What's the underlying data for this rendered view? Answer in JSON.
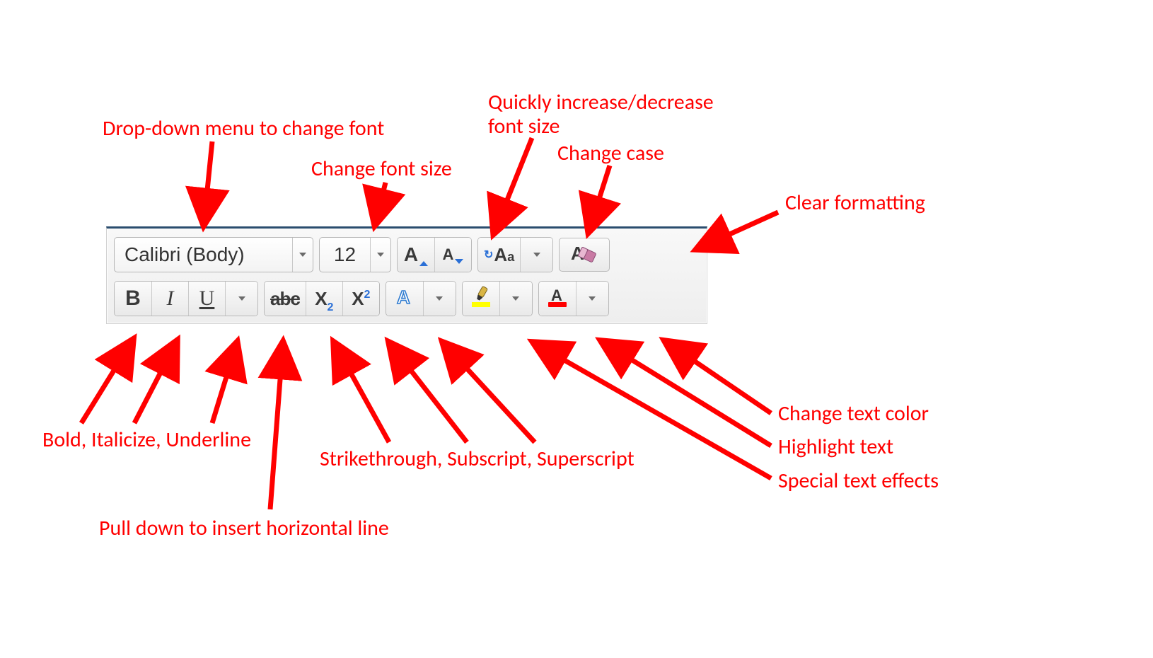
{
  "toolbar": {
    "font_name": "Calibri (Body)",
    "font_size": "12",
    "increaseA": "A",
    "decreaseA": "A",
    "changeCaseA": "A",
    "changeCasea": "a",
    "clearA": "A",
    "boldB": "B",
    "italicI": "I",
    "underlineU": "U",
    "strike_abc": "abc",
    "sub_X": "X",
    "sub_2": "2",
    "sup_X": "X",
    "sup_2": "2",
    "effectsA": "A",
    "highlight_color": "#ffff00",
    "font_color": "#ff0000"
  },
  "labels": {
    "font_dropdown": "Drop-down menu to change font",
    "font_size_label": "Change font size",
    "inc_dec_line1": "Quickly increase/decrease",
    "inc_dec_line2": "font size",
    "change_case": "Change case",
    "clear_formatting": "Clear formatting",
    "biu": "Bold, Italicize, Underline",
    "hr_line": "Pull down to insert horizontal line",
    "sss": "Strikethrough, Subscript, Superscript",
    "text_color": "Change text color",
    "highlight": "Highlight text",
    "effects": "Special text effects"
  }
}
